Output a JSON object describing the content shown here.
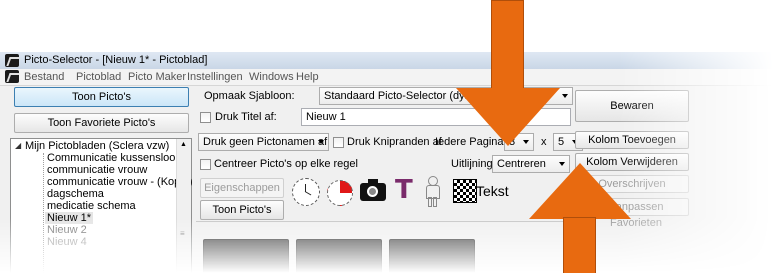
{
  "window": {
    "title": "Picto-Selector - [Nieuw 1* - Pictoblad]"
  },
  "menu": [
    "Bestand",
    "Pictoblad",
    "Picto Maker",
    "Instellingen",
    "Windows",
    "Help"
  ],
  "left": {
    "show_pictos": "Toon Picto's",
    "show_favorites": "Toon Favoriete Picto's",
    "tree_root": "Mijn Pictobladen (Sclera vzw)",
    "tree_items": [
      "Communicatie kussensloop",
      "communicatie vrouw",
      "communicatie vrouw - (Kopie)",
      "dagschema",
      "medicatie schema",
      "Nieuw 1*",
      "Nieuw 2",
      "Nieuw 4"
    ]
  },
  "settings": {
    "template_label": "Opmaak Sjabloon:",
    "template_value": "Standaard Picto-Selector (dynamisch)",
    "print_title_label": "Druk Titel af:",
    "title_value": "Nieuw 1",
    "picto_names": "Druk geen Pictonamen af",
    "cut_edges": "Druk Knipranden af",
    "per_page": "Iedere Pagina",
    "cols": "3",
    "times": "x",
    "rows": "5",
    "center": "Centreer Picto's op elke regel",
    "align_label": "Uitlijning",
    "align_value": "Centreren",
    "properties": "Eigenschappen",
    "show_pictos2": "Toon Picto's",
    "text_label": "Tekst"
  },
  "right": {
    "save": "Bewaren",
    "add_column": "Kolom Toevoegen",
    "remove_column": "Kolom Verwijderen",
    "overwrite": "Overschrijven",
    "favorites": "Aanpassen Favorieten"
  },
  "colors": {
    "arrow": "#e86a10",
    "highlight": "#cbe6f8"
  },
  "icons": [
    "clock-icon",
    "pie-chart-icon",
    "camera-icon",
    "text-T-icon",
    "person-outline-icon",
    "qr-code-icon",
    "star-icon"
  ]
}
